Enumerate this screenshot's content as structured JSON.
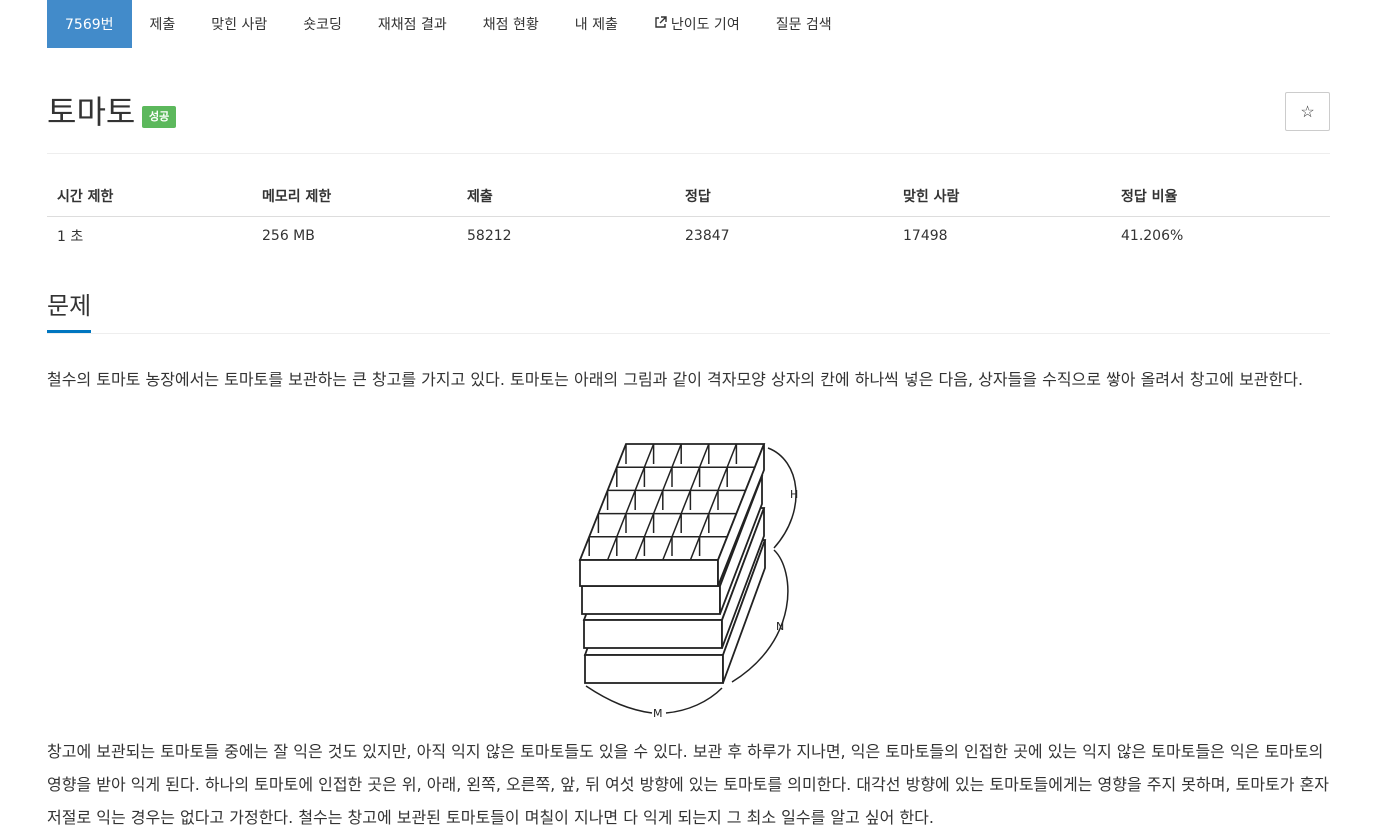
{
  "nav": {
    "items": [
      {
        "label": "7569번",
        "active": true
      },
      {
        "label": "제출"
      },
      {
        "label": "맞힌 사람"
      },
      {
        "label": "숏코딩"
      },
      {
        "label": "재채점 결과"
      },
      {
        "label": "채점 현황"
      },
      {
        "label": "내 제출"
      },
      {
        "label": "난이도 기여",
        "icon": "external-link-icon"
      },
      {
        "label": "질문 검색"
      }
    ]
  },
  "problem": {
    "title": "토마토",
    "badge": "성공",
    "star_icon": "☆"
  },
  "stats": {
    "headers": [
      "시간 제한",
      "메모리 제한",
      "제출",
      "정답",
      "맞힌 사람",
      "정답 비율"
    ],
    "values": [
      "1 초",
      "256 MB",
      "58212",
      "23847",
      "17498",
      "41.206%"
    ]
  },
  "section": {
    "title": "문제"
  },
  "body": {
    "p1": "철수의 토마토 농장에서는 토마토를 보관하는 큰 창고를 가지고 있다. 토마토는 아래의 그림과 같이 격자모양 상자의 칸에 하나씩 넣은 다음, 상자들을 수직으로 쌓아 올려서 창고에 보관한다.",
    "p2": "창고에 보관되는 토마토들 중에는 잘 익은 것도 있지만, 아직 익지 않은 토마토들도 있을 수 있다. 보관 후 하루가 지나면, 익은 토마토들의 인접한 곳에 있는 익지 않은 토마토들은 익은 토마토의 영향을 받아 익게 된다. 하나의 토마토에 인접한 곳은 위, 아래, 왼쪽, 오른쪽, 앞, 뒤 여섯 방향에 있는 토마토를 의미한다. 대각선 방향에 있는 토마토들에게는 영향을 주지 못하며, 토마토가 혼자 저절로 익는 경우는 없다고 가정한다. 철수는 창고에 보관된 토마토들이 며칠이 지나면 다 익게 되는지 그 최소 일수를 알고 싶어 한다."
  },
  "figure": {
    "label_h": "H",
    "label_n": "N",
    "label_m": "M"
  },
  "colors": {
    "nav_active": "#428bca",
    "badge_success": "#5cb85c",
    "section_underline": "#0076c0"
  }
}
